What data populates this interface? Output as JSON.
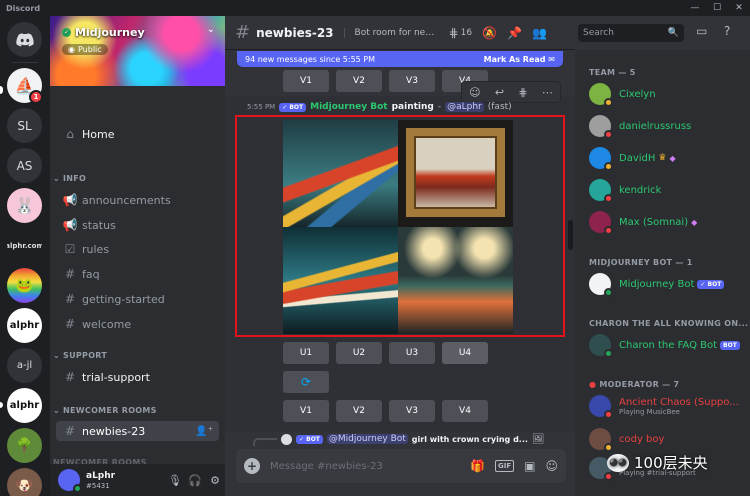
{
  "window": {
    "title": "Discord",
    "min": "—",
    "max": "☐",
    "close": "✕"
  },
  "rail": {
    "home_icon": "discord-logo",
    "servers": [
      {
        "label": "",
        "icon": "sailboat-icon",
        "badge": "1"
      },
      {
        "label": "SL"
      },
      {
        "label": "AS"
      },
      {
        "label": "",
        "icon": "pink-character"
      },
      {
        "label": "alphr.com"
      },
      {
        "label": "",
        "icon": "rainbow-frog"
      },
      {
        "label": "alphr"
      },
      {
        "label": "a-jl"
      },
      {
        "label": "alphr"
      },
      {
        "label": "",
        "icon": "pixel-art"
      },
      {
        "label": "",
        "icon": "dog-avatar"
      }
    ]
  },
  "sidebar": {
    "server_name": "Midjourney",
    "public_label": "Public",
    "home": "Home",
    "categories": [
      {
        "name": "INFO",
        "channels": [
          "announcements",
          "status",
          "rules",
          "faq",
          "getting-started",
          "welcome"
        ]
      },
      {
        "name": "SUPPORT",
        "channels": [
          "trial-support"
        ]
      },
      {
        "name": "NEWCOMER ROOMS",
        "channels": [
          "newbies-23"
        ]
      },
      {
        "name": "NEWCOMER ROOMS"
      }
    ]
  },
  "user": {
    "name": "aLphr",
    "tag": "#5431"
  },
  "header": {
    "channel": "newbies-23",
    "topic": "Bot room for new users. Type /imagine",
    "thread_count": "16",
    "search_placeholder": "Search"
  },
  "chat": {
    "new_messages": "94 new messages since 5:55 PM",
    "mark_read": "Mark As Read",
    "top_buttons": [
      "V1",
      "V2",
      "V3",
      "V4"
    ],
    "message": {
      "time": "5:55 PM",
      "bot_tag": "BOT",
      "author": "Midjourney Bot",
      "prompt": "painting",
      "dash": "-",
      "mention": "@aLphr",
      "mode": "(fast)"
    },
    "upscale_buttons": [
      "U1",
      "U2",
      "U3",
      "U4"
    ],
    "variation_buttons": [
      "V1",
      "V2",
      "V3",
      "V4"
    ],
    "refresh_icon": "refresh-icon",
    "reply": {
      "bot_tag": "BOT",
      "mention": "@Midjourney Bot",
      "text": "girl with crown crying d..."
    },
    "input_placeholder": "Message #newbies-23"
  },
  "members": {
    "groups": [
      {
        "name": "TEAM — 5",
        "members": [
          {
            "name": "Cixelyn",
            "color": "#2dc770"
          },
          {
            "name": "danielrussruss",
            "color": "#2dc770"
          },
          {
            "name": "DavidH",
            "color": "#2dc770"
          },
          {
            "name": "kendrick",
            "color": "#2dc770"
          },
          {
            "name": "Max (Somnai)",
            "color": "#2dc770"
          }
        ]
      },
      {
        "name": "MIDJOURNEY BOT — 1",
        "members": [
          {
            "name": "Midjourney Bot",
            "color": "#2dc770",
            "bot": "BOT"
          }
        ]
      },
      {
        "name": "CHARON THE ALL KNOWING ON...",
        "members": [
          {
            "name": "Charon the FAQ Bot",
            "color": "#2dc770",
            "bot": "BOT"
          }
        ]
      },
      {
        "name": "MODERATOR — 7",
        "members": [
          {
            "name": "Ancient Chaos (Suppo...",
            "color": "#e8413f",
            "sub": "Playing MusicBee"
          },
          {
            "name": "cody boy",
            "color": "#e8413f"
          },
          {
            "name": "",
            "color": "#e8413f",
            "sub": "Playing #trial-support"
          }
        ]
      }
    ]
  },
  "watermark": "100层未央",
  "colors": {
    "accent": "#5865f2",
    "online": "#23a55a",
    "dnd": "#f23f43",
    "mod": "#e8413f",
    "team": "#2dc770",
    "highlight": "#e1131b"
  }
}
